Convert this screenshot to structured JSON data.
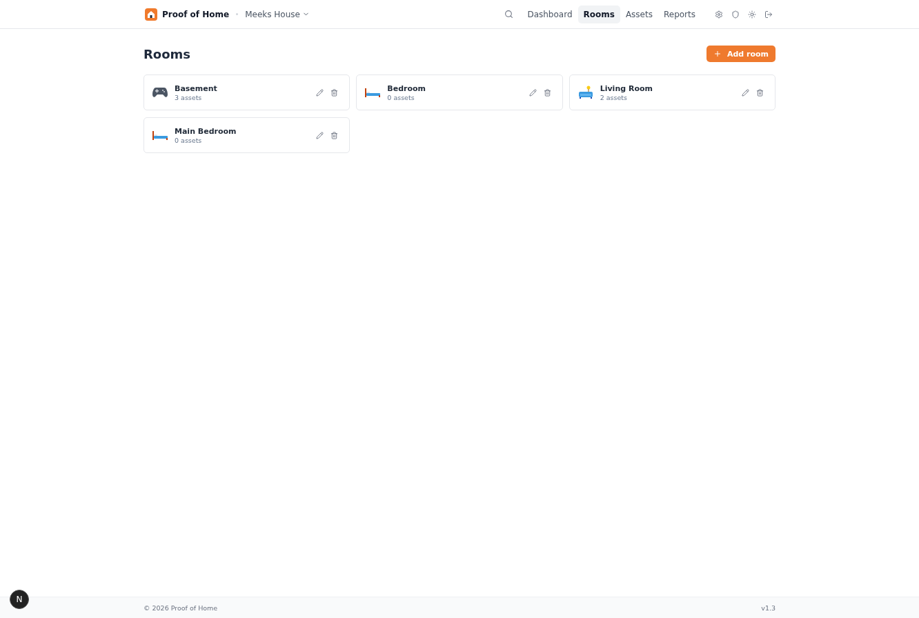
{
  "brand": {
    "name": "Proof of Home"
  },
  "house_switcher": {
    "label": "Meeks House"
  },
  "nav": [
    {
      "label": "Dashboard",
      "selected": false
    },
    {
      "label": "Rooms",
      "selected": true
    },
    {
      "label": "Assets",
      "selected": false
    },
    {
      "label": "Reports",
      "selected": false
    }
  ],
  "page": {
    "title": "Rooms",
    "add_button": "Add room"
  },
  "rooms": [
    {
      "name": "Basement",
      "count": "3 assets",
      "kind": "game"
    },
    {
      "name": "Bedroom",
      "count": "0 assets",
      "kind": "bed"
    },
    {
      "name": "Living Room",
      "count": "2 assets",
      "kind": "couch"
    },
    {
      "name": "Main Bedroom",
      "count": "0 assets",
      "kind": "bed"
    }
  ],
  "dev_badge": "N",
  "footer": {
    "copyright": "© 2026 Proof of Home",
    "version": "v1.3"
  }
}
